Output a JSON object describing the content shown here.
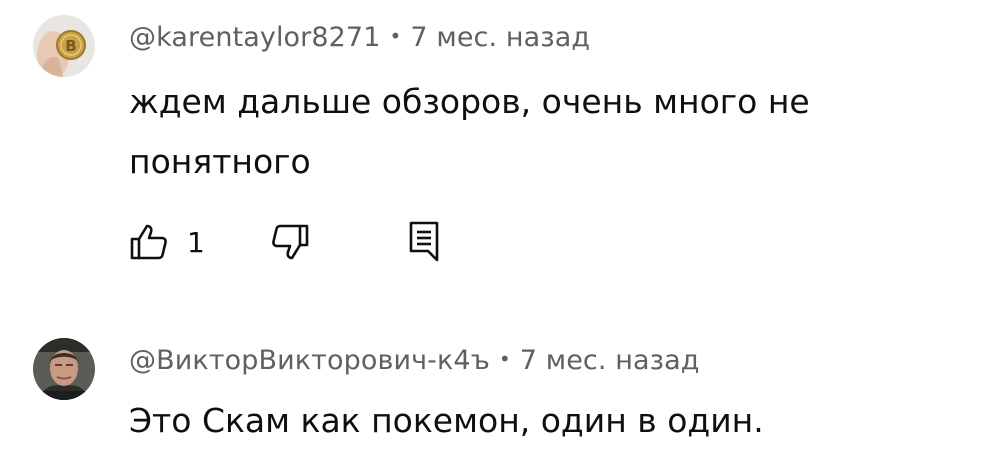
{
  "comments": [
    {
      "author": "@karentaylor8271",
      "separator": "•",
      "time": "7 мес. назад",
      "text_lines": [
        "ждем дальше обзоров, очень много не",
        "понятного"
      ],
      "likes": "1",
      "avatar": {
        "icon": "bitcoin-coin-avatar",
        "accent": "#c9a14a"
      }
    },
    {
      "author": "@ВикторВикторович-к4ъ",
      "separator": "•",
      "time": "7 мес. назад",
      "text_lines": [
        "Это Скам как покемон, один в один."
      ],
      "avatar": {
        "icon": "man-portrait-avatar"
      }
    }
  ],
  "icons": {
    "like": "thumbs-up-icon",
    "dislike": "thumbs-down-icon",
    "reply": "reply-comment-icon"
  },
  "colors": {
    "meta_text": "#606060",
    "body_text": "#0f0f0f",
    "background": "#ffffff"
  }
}
